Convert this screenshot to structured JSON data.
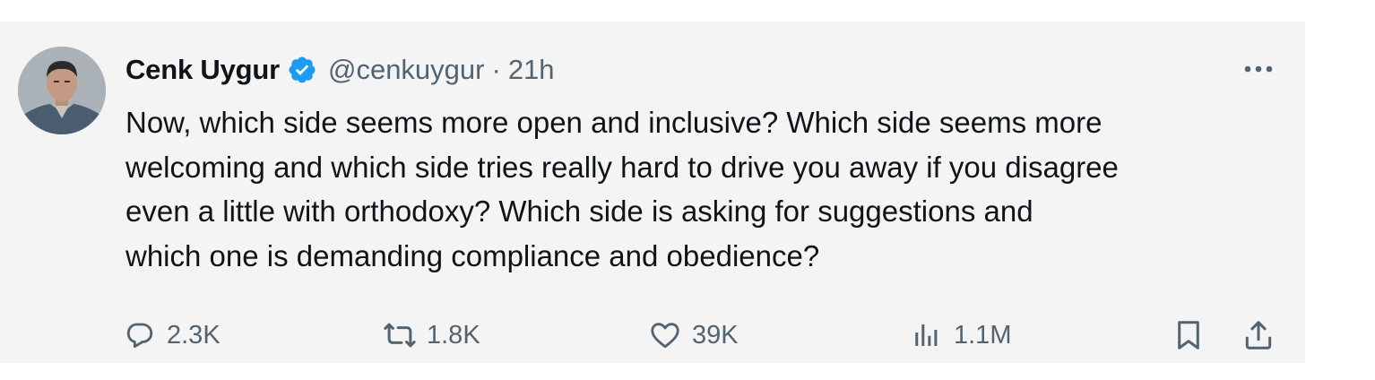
{
  "tweet": {
    "author_name": "Cenk Uygur",
    "handle": "@cenkuygur",
    "separator": "·",
    "time": "21h",
    "text_lines": [
      "Now, which side seems more open and inclusive? Which side seems more",
      "welcoming and which side tries really hard to drive you away if you disagree",
      "even a little with orthodoxy? Which side is asking for suggestions and",
      "which one is demanding compliance and obedience?"
    ]
  },
  "actions": {
    "replies": "2.3K",
    "reposts": "1.8K",
    "likes": "39K",
    "views": "1.1M"
  },
  "colors": {
    "card_background": "#f4f4f4",
    "verified_badge": "#1d9bf0",
    "text_primary": "#0f1419",
    "text_secondary": "#536471"
  },
  "icons": [
    "verified-badge-icon",
    "more-icon",
    "reply-icon",
    "repost-icon",
    "like-icon",
    "views-icon",
    "bookmark-icon",
    "share-icon"
  ]
}
